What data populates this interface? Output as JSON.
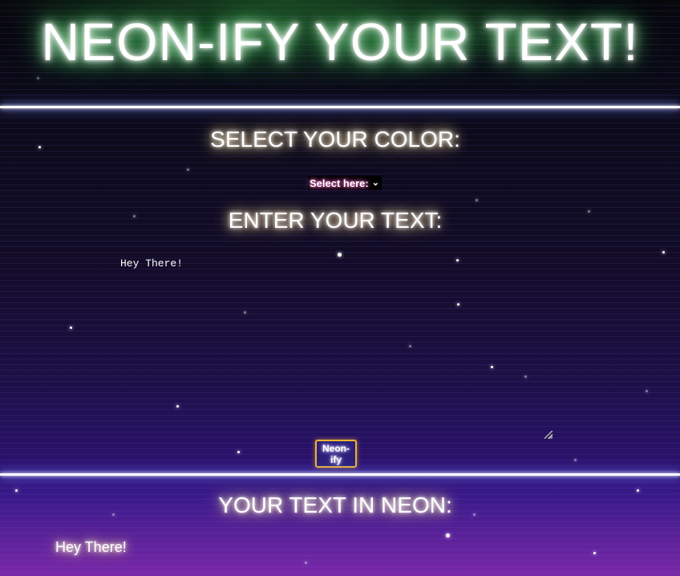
{
  "header": {
    "title": "NEON-IFY YOUR TEXT!"
  },
  "color_section": {
    "heading": "SELECT YOUR COLOR:",
    "select": {
      "selected_label": "Select here:",
      "icon": "chevron-down-icon"
    }
  },
  "text_section": {
    "heading": "ENTER YOUR TEXT:",
    "input_value": "Hey There!",
    "button_label": "Neon-ify"
  },
  "output_section": {
    "heading": "YOUR TEXT IN NEON:",
    "output_text": "Hey There!"
  },
  "colors": {
    "title_glow": "#5cff7a",
    "heading_glow": "#ffd27a",
    "divider_glow": "#5a6cff",
    "button_border": "#f0b430",
    "button_fill": "#2a1f7a",
    "background_bottom": "#7a28a8"
  }
}
